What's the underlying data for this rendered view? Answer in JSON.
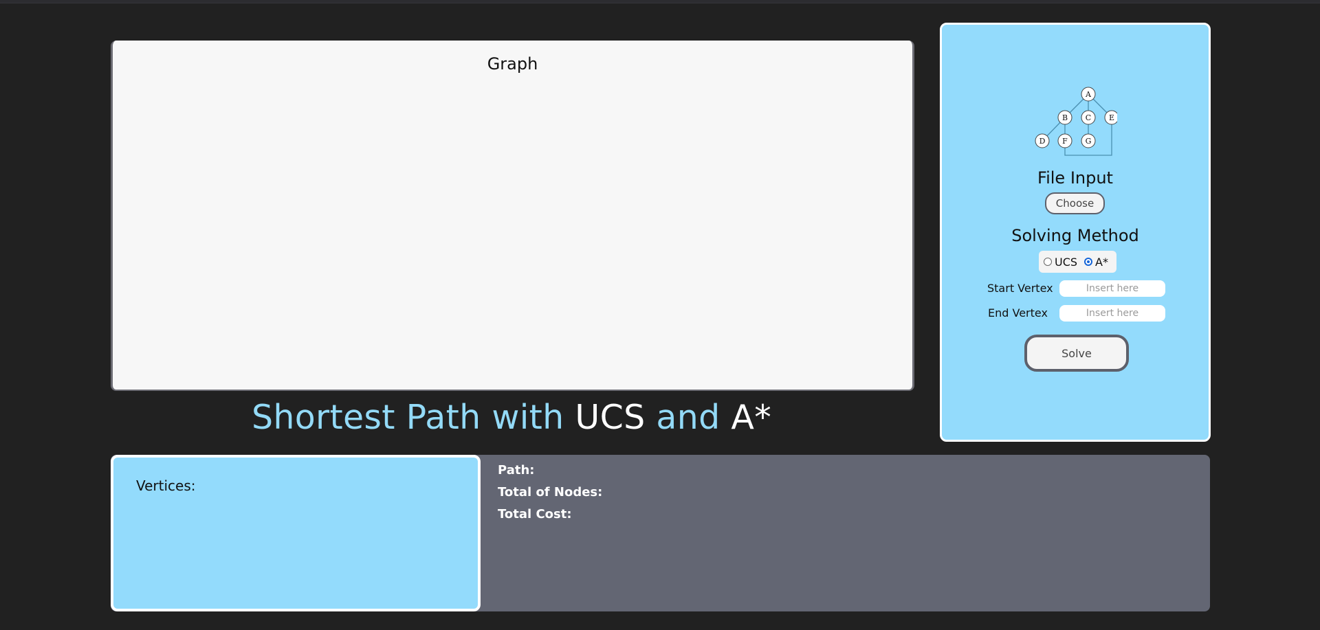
{
  "graph": {
    "title": "Graph"
  },
  "main_title": {
    "part1": "Shortest Path with",
    "part2": "UCS",
    "part3": "and",
    "part4": "A*"
  },
  "side_panel": {
    "tree_nodes": [
      "A",
      "B",
      "C",
      "E",
      "D",
      "F",
      "G"
    ],
    "file_input_heading": "File Input",
    "choose_label": "Choose",
    "solving_method_heading": "Solving Method",
    "methods": [
      {
        "label": "UCS",
        "checked": false
      },
      {
        "label": "A*",
        "checked": true
      }
    ],
    "start_vertex_label": "Start Vertex",
    "start_vertex_placeholder": "Insert here",
    "end_vertex_label": "End Vertex",
    "end_vertex_placeholder": "Insert here",
    "solve_label": "Solve"
  },
  "results": {
    "vertices_label": "Vertices:",
    "path_label": "Path:",
    "total_nodes_label": "Total of Nodes:",
    "total_cost_label": "Total Cost:"
  },
  "colors": {
    "background": "#212121",
    "accent_blue": "#93dbfc",
    "panel_gray": "#636673",
    "graph_bg": "#f7f7f7"
  }
}
